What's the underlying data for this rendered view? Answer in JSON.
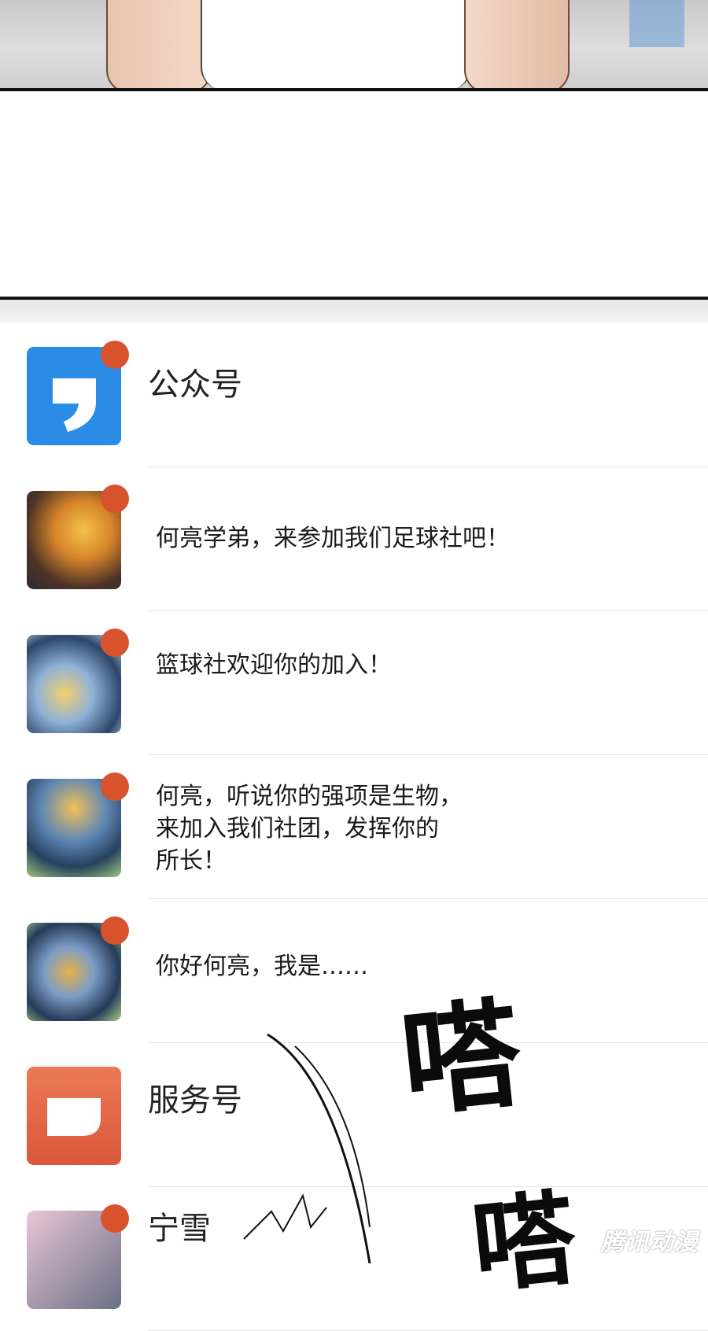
{
  "conversations": [
    {
      "kind": "title",
      "text": "公众号",
      "avatar": "official-account-icon",
      "unread": true
    },
    {
      "kind": "message",
      "lines": [
        "何亮学弟，来参加我们足球社吧！"
      ],
      "avatar": "art-avatar-1",
      "unread": true
    },
    {
      "kind": "message",
      "lines": [
        "篮球社欢迎你的加入！"
      ],
      "avatar": "art-avatar-2",
      "unread": true
    },
    {
      "kind": "message",
      "lines": [
        "何亮，听说你的强项是生物，",
        "来加入我们社团，发挥你的",
        "所长！"
      ],
      "avatar": "art-avatar-3",
      "unread": true
    },
    {
      "kind": "message",
      "lines": [
        "你好何亮，我是……"
      ],
      "avatar": "art-avatar-4",
      "unread": true
    },
    {
      "kind": "title",
      "text": "服务号",
      "avatar": "service-account-icon",
      "unread": false
    },
    {
      "kind": "title",
      "text": "宁雪",
      "avatar": "art-avatar-5",
      "unread": true
    }
  ],
  "sound_effects": [
    "嗒",
    "嗒"
  ],
  "watermark": "腾讯动漫",
  "colors": {
    "badge": "#d8522d",
    "official_blue": "#2b8ce6",
    "service_orange": "#e26a47"
  }
}
